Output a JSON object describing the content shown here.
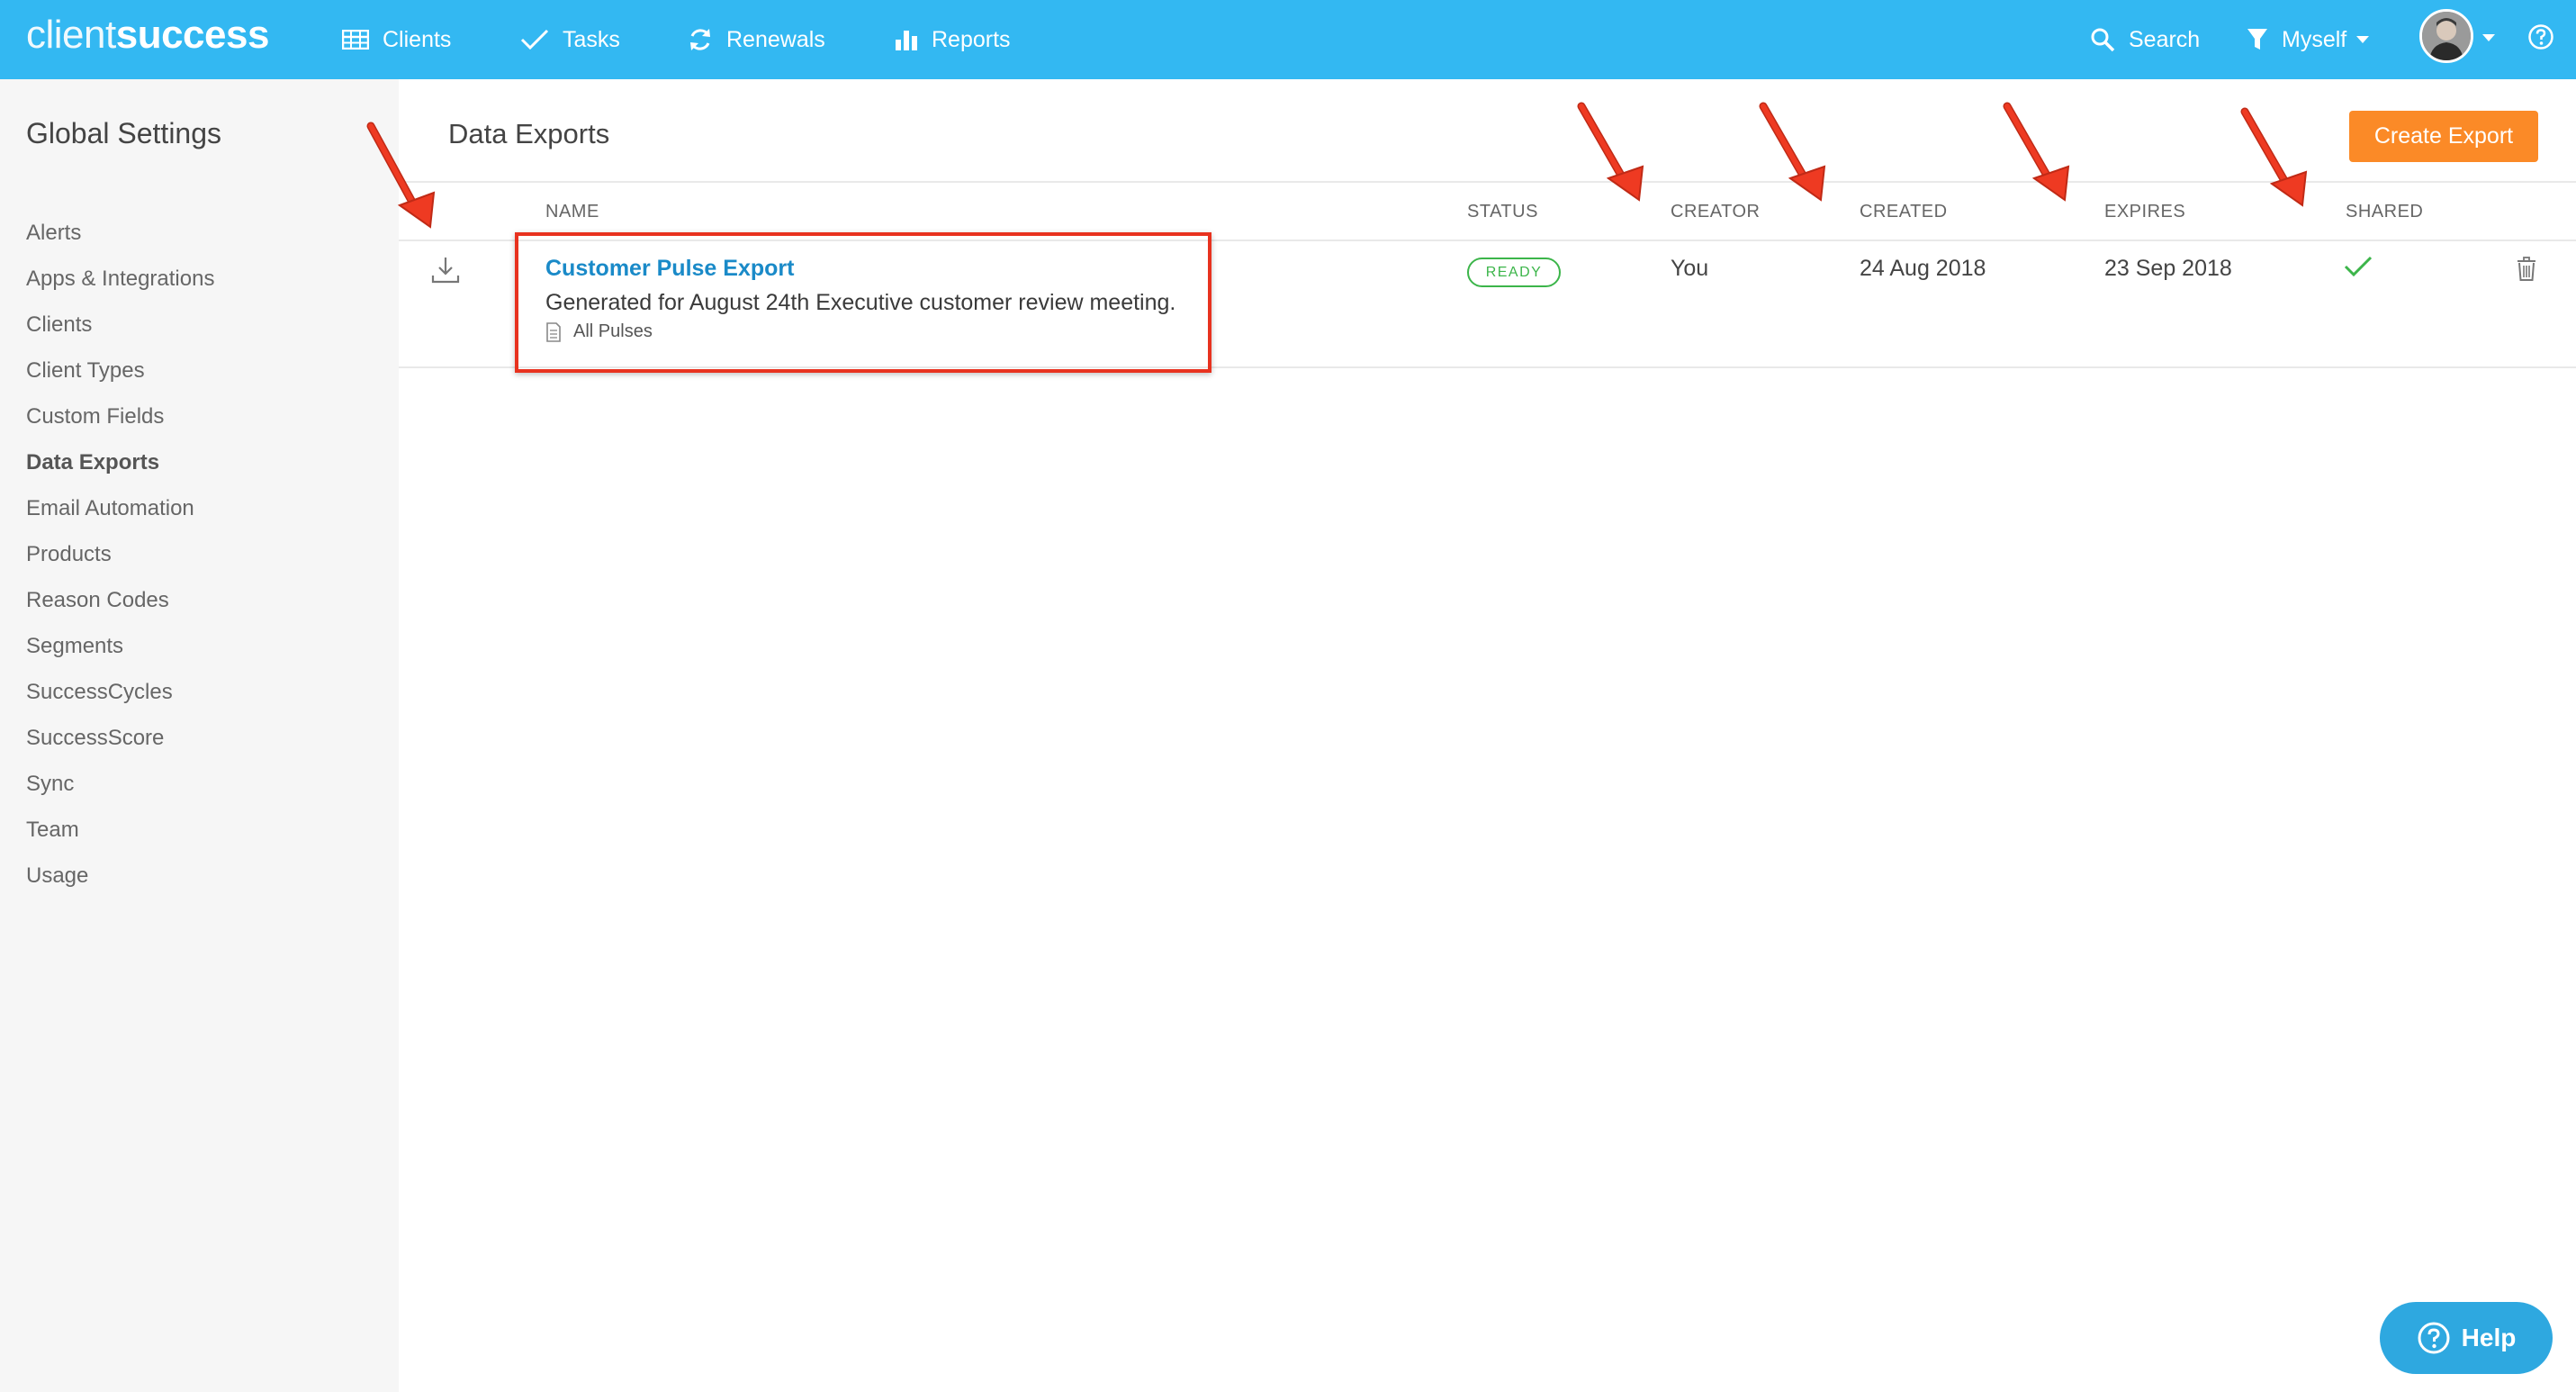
{
  "app": {
    "logo_thin": "client",
    "logo_bold": "success"
  },
  "nav": {
    "items": [
      {
        "label": "Clients",
        "icon": "table-icon"
      },
      {
        "label": "Tasks",
        "icon": "check-icon"
      },
      {
        "label": "Renewals",
        "icon": "refresh-icon"
      },
      {
        "label": "Reports",
        "icon": "bar-chart-icon"
      }
    ],
    "search_label": "Search",
    "filter_label": "Myself"
  },
  "sidebar": {
    "title": "Global Settings",
    "items": [
      {
        "label": "Alerts"
      },
      {
        "label": "Apps & Integrations"
      },
      {
        "label": "Clients"
      },
      {
        "label": "Client Types"
      },
      {
        "label": "Custom Fields"
      },
      {
        "label": "Data Exports",
        "active": true
      },
      {
        "label": "Email Automation"
      },
      {
        "label": "Products"
      },
      {
        "label": "Reason Codes"
      },
      {
        "label": "Segments"
      },
      {
        "label": "SuccessCycles"
      },
      {
        "label": "SuccessScore"
      },
      {
        "label": "Sync"
      },
      {
        "label": "Team"
      },
      {
        "label": "Usage"
      }
    ]
  },
  "main": {
    "title": "Data Exports",
    "create_label": "Create Export",
    "columns": {
      "name": "NAME",
      "status": "STATUS",
      "creator": "CREATOR",
      "created": "CREATED",
      "expires": "EXPIRES",
      "shared": "SHARED"
    },
    "rows": [
      {
        "name": "Customer Pulse Export",
        "description": "Generated for August 24th Executive customer review meeting.",
        "tag": "All Pulses",
        "status": "READY",
        "creator": "You",
        "created": "24 Aug 2018",
        "expires": "23 Sep 2018",
        "shared": true
      }
    ]
  },
  "help": {
    "label": "Help"
  },
  "colors": {
    "topbar": "#33b8f2",
    "accent_orange": "#fb8a27",
    "link_blue": "#1a8ac8",
    "ready_green": "#3cb54a",
    "annotation_red": "#e8321f"
  }
}
